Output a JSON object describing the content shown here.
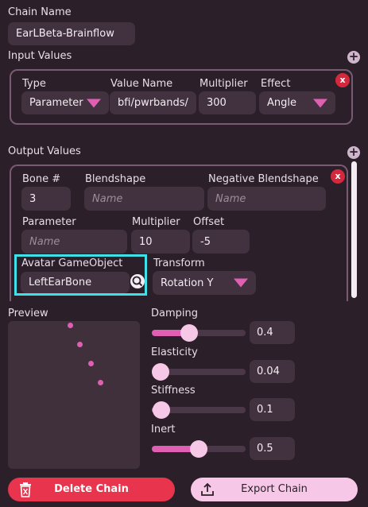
{
  "chain_name": {
    "label": "Chain Name",
    "value": "EarLBeta-Brainflow"
  },
  "input_values": {
    "title": "Input Values",
    "add_icon": "plus-circle-icon",
    "remove_label": "x",
    "type": {
      "label": "Type",
      "value": "Parameter"
    },
    "value_name": {
      "label": "Value Name",
      "value": "bfi/pwrbands/"
    },
    "multiplier": {
      "label": "Multiplier",
      "value": "300"
    },
    "effect": {
      "label": "Effect",
      "value": "Angle"
    }
  },
  "output_values": {
    "title": "Output Values",
    "add_icon": "plus-circle-icon",
    "remove_label": "x",
    "bone": {
      "label": "Bone #",
      "value": "3"
    },
    "blendshape": {
      "label": "Blendshape",
      "placeholder": "Name"
    },
    "negative_blendshape": {
      "label": "Negative Blendshape",
      "placeholder": "Name"
    },
    "parameter": {
      "label": "Parameter",
      "placeholder": "Name"
    },
    "multiplier": {
      "label": "Multiplier",
      "value": "10"
    },
    "offset": {
      "label": "Offset",
      "value": "-5"
    },
    "avatar_gameobject": {
      "label": "Avatar GameObject",
      "value": "LeftEarBone",
      "icon": "search-icon"
    },
    "transform": {
      "label": "Transform",
      "value": "Rotation Y"
    }
  },
  "preview": {
    "title": "Preview"
  },
  "sliders": [
    {
      "label": "Damping",
      "value": "0.4",
      "level": 0.4
    },
    {
      "label": "Elasticity",
      "value": "0.04",
      "level": 0.04
    },
    {
      "label": "Stiffness",
      "value": "0.1",
      "level": 0.1
    },
    {
      "label": "Inert",
      "value": "0.5",
      "level": 0.5
    }
  ],
  "actions": {
    "delete_label": "Delete Chain",
    "delete_icon": "trash-icon",
    "export_label": "Export Chain",
    "export_icon": "upload-icon"
  },
  "colors": {
    "accent": "#e05fb3",
    "danger": "#e8344c",
    "highlight": "#3fe0e8",
    "export_bg": "#f6c7e6"
  }
}
